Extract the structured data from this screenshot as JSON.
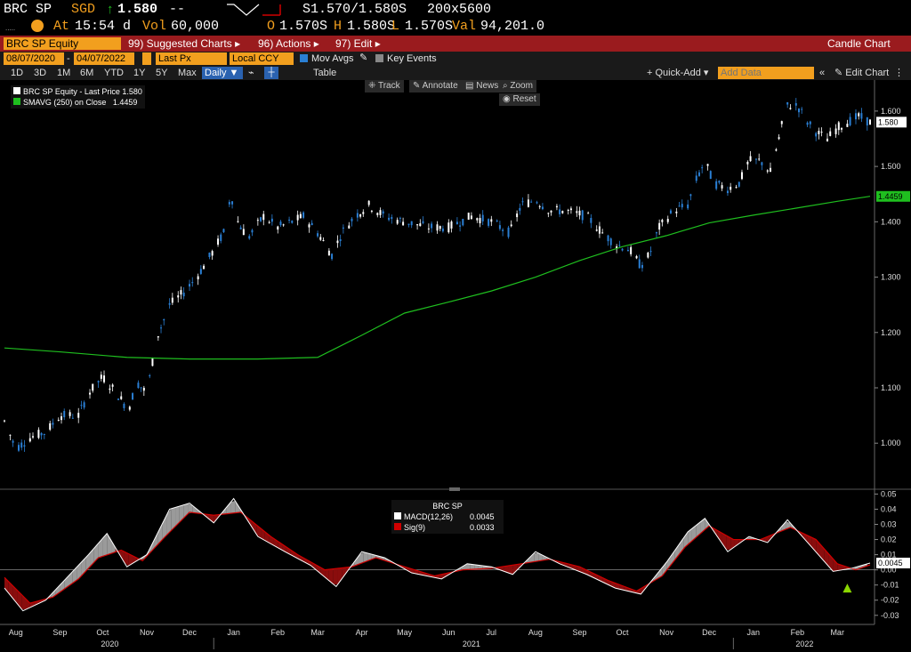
{
  "quote": {
    "ticker": "BRC SP",
    "currency": "SGD",
    "arrow": "↑",
    "last": "1.580",
    "change": "--",
    "bid_ask": "S1.570/1.580S",
    "size": "200x5600",
    "time_label": "At",
    "time": "15:54 d",
    "vol_label": "Vol",
    "vol": "60,000",
    "open_label": "O",
    "open": "1.570S",
    "high_label": "H",
    "high": "1.580S",
    "low_label": "L",
    "low": "1.570S",
    "val_label": "Val",
    "val": "94,201.0"
  },
  "menu": {
    "security": "BRC SP Equity",
    "suggested": "99) Suggested Charts ▸",
    "actions": "96) Actions ▸",
    "edit": "97) Edit ▸",
    "chart_type": "Candle Chart"
  },
  "controls": {
    "start_date": "08/07/2020",
    "end_date": "04/07/2022",
    "price_field": "Last Px",
    "currency": "Local CCY",
    "mov_avgs": "Mov Avgs",
    "key_events": "Key Events",
    "periods": [
      "1D",
      "3D",
      "1M",
      "6M",
      "YTD",
      "1Y",
      "5Y",
      "Max"
    ],
    "frequency": "Daily ▼",
    "table": "Table",
    "quick_add": "+ Quick-Add ▾",
    "add_data_placeholder": "Add Data",
    "edit_chart": "✎ Edit Chart",
    "track": "Track",
    "annotate": "Annotate",
    "news": "News",
    "zoom": "Zoom",
    "reset": "Reset"
  },
  "colors": {
    "up_candle": "#ffffff",
    "down_candle": "#2a7fd4",
    "sma": "#1fbf1f",
    "macd": "#ffffff",
    "signal": "#d00000",
    "menu_bar": "#9a1b1e",
    "orange": "#f29f1e"
  },
  "chart_data": [
    {
      "type": "line",
      "legend": [
        {
          "label": "BRC SP Equity - Last Price 1.580",
          "color": "#ffffff"
        },
        {
          "label": "SMAVG (250) on Close",
          "value": "1.4459",
          "color": "#1fbf1f"
        }
      ],
      "price_type": "candlestick",
      "ylim": [
        0.92,
        1.64
      ],
      "yticks": [
        "1.000",
        "1.100",
        "1.200",
        "1.300",
        "1.400",
        "1.500",
        "1.600"
      ],
      "ytick_values": [
        1.0,
        1.1,
        1.2,
        1.3,
        1.4,
        1.5,
        1.6
      ],
      "last_price_label": "1.580",
      "sma_label": "1.4459",
      "price_series": [
        {
          "x": "2020-08-07",
          "y": 1.04
        },
        {
          "x": "2020-08-15",
          "y": 0.99
        },
        {
          "x": "2020-08-25",
          "y": 1.01
        },
        {
          "x": "2020-09-05",
          "y": 1.02
        },
        {
          "x": "2020-09-15",
          "y": 1.05
        },
        {
          "x": "2020-09-28",
          "y": 1.05
        },
        {
          "x": "2020-10-05",
          "y": 1.09
        },
        {
          "x": "2020-10-15",
          "y": 1.12
        },
        {
          "x": "2020-10-25",
          "y": 1.09
        },
        {
          "x": "2020-11-02",
          "y": 1.06
        },
        {
          "x": "2020-11-08",
          "y": 1.11
        },
        {
          "x": "2020-11-15",
          "y": 1.09
        },
        {
          "x": "2020-11-22",
          "y": 1.19
        },
        {
          "x": "2020-12-01",
          "y": 1.25
        },
        {
          "x": "2020-12-10",
          "y": 1.27
        },
        {
          "x": "2020-12-20",
          "y": 1.3
        },
        {
          "x": "2020-12-30",
          "y": 1.34
        },
        {
          "x": "2021-01-08",
          "y": 1.38
        },
        {
          "x": "2021-01-13",
          "y": 1.45
        },
        {
          "x": "2021-01-18",
          "y": 1.4
        },
        {
          "x": "2021-01-25",
          "y": 1.37
        },
        {
          "x": "2021-02-05",
          "y": 1.41
        },
        {
          "x": "2021-02-15",
          "y": 1.39
        },
        {
          "x": "2021-02-25",
          "y": 1.4
        },
        {
          "x": "2021-03-05",
          "y": 1.41
        },
        {
          "x": "2021-03-15",
          "y": 1.38
        },
        {
          "x": "2021-03-25",
          "y": 1.34
        },
        {
          "x": "2021-04-01",
          "y": 1.38
        },
        {
          "x": "2021-04-10",
          "y": 1.41
        },
        {
          "x": "2021-04-20",
          "y": 1.43
        },
        {
          "x": "2021-05-01",
          "y": 1.41
        },
        {
          "x": "2021-05-15",
          "y": 1.4
        },
        {
          "x": "2021-06-01",
          "y": 1.39
        },
        {
          "x": "2021-06-15",
          "y": 1.39
        },
        {
          "x": "2021-07-01",
          "y": 1.41
        },
        {
          "x": "2021-07-15",
          "y": 1.4
        },
        {
          "x": "2021-07-28",
          "y": 1.38
        },
        {
          "x": "2021-08-05",
          "y": 1.43
        },
        {
          "x": "2021-08-15",
          "y": 1.44
        },
        {
          "x": "2021-08-25",
          "y": 1.42
        },
        {
          "x": "2021-09-05",
          "y": 1.42
        },
        {
          "x": "2021-09-20",
          "y": 1.41
        },
        {
          "x": "2021-10-01",
          "y": 1.38
        },
        {
          "x": "2021-10-10",
          "y": 1.36
        },
        {
          "x": "2021-10-20",
          "y": 1.35
        },
        {
          "x": "2021-10-28",
          "y": 1.32
        },
        {
          "x": "2021-11-03",
          "y": 1.34
        },
        {
          "x": "2021-11-10",
          "y": 1.39
        },
        {
          "x": "2021-11-20",
          "y": 1.42
        },
        {
          "x": "2021-11-30",
          "y": 1.43
        },
        {
          "x": "2021-12-05",
          "y": 1.47
        },
        {
          "x": "2021-12-12",
          "y": 1.51
        },
        {
          "x": "2021-12-18",
          "y": 1.47
        },
        {
          "x": "2021-12-28",
          "y": 1.46
        },
        {
          "x": "2022-01-05",
          "y": 1.47
        },
        {
          "x": "2022-01-12",
          "y": 1.51
        },
        {
          "x": "2022-01-20",
          "y": 1.51
        },
        {
          "x": "2022-01-27",
          "y": 1.49
        },
        {
          "x": "2022-02-02",
          "y": 1.55
        },
        {
          "x": "2022-02-07",
          "y": 1.61
        },
        {
          "x": "2022-02-15",
          "y": 1.61
        },
        {
          "x": "2022-02-22",
          "y": 1.58
        },
        {
          "x": "2022-03-01",
          "y": 1.56
        },
        {
          "x": "2022-03-08",
          "y": 1.55
        },
        {
          "x": "2022-03-15",
          "y": 1.57
        },
        {
          "x": "2022-03-22",
          "y": 1.58
        },
        {
          "x": "2022-03-30",
          "y": 1.59
        },
        {
          "x": "2022-04-07",
          "y": 1.58
        }
      ],
      "sma_series": [
        {
          "x": "2020-08-07",
          "y": 1.172
        },
        {
          "x": "2020-09-15",
          "y": 1.165
        },
        {
          "x": "2020-11-01",
          "y": 1.155
        },
        {
          "x": "2020-12-15",
          "y": 1.152
        },
        {
          "x": "2021-02-01",
          "y": 1.152
        },
        {
          "x": "2021-03-15",
          "y": 1.155
        },
        {
          "x": "2021-04-15",
          "y": 1.195
        },
        {
          "x": "2021-05-15",
          "y": 1.235
        },
        {
          "x": "2021-06-15",
          "y": 1.255
        },
        {
          "x": "2021-07-15",
          "y": 1.275
        },
        {
          "x": "2021-08-15",
          "y": 1.3
        },
        {
          "x": "2021-09-15",
          "y": 1.33
        },
        {
          "x": "2021-10-15",
          "y": 1.355
        },
        {
          "x": "2021-11-15",
          "y": 1.375
        },
        {
          "x": "2021-12-15",
          "y": 1.398
        },
        {
          "x": "2022-01-15",
          "y": 1.412
        },
        {
          "x": "2022-02-15",
          "y": 1.425
        },
        {
          "x": "2022-03-15",
          "y": 1.437
        },
        {
          "x": "2022-04-07",
          "y": 1.446
        }
      ]
    },
    {
      "type": "line",
      "title": "BRC SP",
      "series": [
        {
          "name": "MACD(12,26)",
          "value": "0.0045"
        },
        {
          "name": "Sig(9)",
          "value": "0.0033"
        }
      ],
      "ylim": [
        -0.036,
        0.052
      ],
      "yticks": [
        "0.05",
        "0.04",
        "0.03",
        "0.02",
        "0.01",
        "0.00",
        "-0.01",
        "-0.02",
        "-0.03"
      ],
      "ytick_values": [
        0.05,
        0.04,
        0.03,
        0.02,
        0.01,
        0.0,
        -0.01,
        -0.02,
        -0.03
      ],
      "last_label": "0.0045",
      "macd_series": [
        {
          "x": "2020-08-07",
          "y": -0.012
        },
        {
          "x": "2020-08-20",
          "y": -0.027
        },
        {
          "x": "2020-09-05",
          "y": -0.02
        },
        {
          "x": "2020-09-20",
          "y": -0.005
        },
        {
          "x": "2020-10-05",
          "y": 0.01
        },
        {
          "x": "2020-10-18",
          "y": 0.024
        },
        {
          "x": "2020-11-01",
          "y": 0.002
        },
        {
          "x": "2020-11-15",
          "y": 0.01
        },
        {
          "x": "2020-12-01",
          "y": 0.04
        },
        {
          "x": "2020-12-15",
          "y": 0.044
        },
        {
          "x": "2021-01-01",
          "y": 0.031
        },
        {
          "x": "2021-01-15",
          "y": 0.047
        },
        {
          "x": "2021-02-01",
          "y": 0.022
        },
        {
          "x": "2021-02-20",
          "y": 0.012
        },
        {
          "x": "2021-03-10",
          "y": 0.003
        },
        {
          "x": "2021-03-28",
          "y": -0.011
        },
        {
          "x": "2021-04-15",
          "y": 0.012
        },
        {
          "x": "2021-05-01",
          "y": 0.008
        },
        {
          "x": "2021-05-20",
          "y": -0.002
        },
        {
          "x": "2021-06-10",
          "y": -0.006
        },
        {
          "x": "2021-06-28",
          "y": 0.004
        },
        {
          "x": "2021-07-15",
          "y": 0.002
        },
        {
          "x": "2021-07-30",
          "y": -0.003
        },
        {
          "x": "2021-08-15",
          "y": 0.012
        },
        {
          "x": "2021-09-01",
          "y": 0.004
        },
        {
          "x": "2021-09-20",
          "y": -0.003
        },
        {
          "x": "2021-10-10",
          "y": -0.012
        },
        {
          "x": "2021-10-28",
          "y": -0.016
        },
        {
          "x": "2021-11-15",
          "y": 0.005
        },
        {
          "x": "2021-11-30",
          "y": 0.025
        },
        {
          "x": "2021-12-12",
          "y": 0.034
        },
        {
          "x": "2021-12-28",
          "y": 0.012
        },
        {
          "x": "2022-01-12",
          "y": 0.022
        },
        {
          "x": "2022-01-25",
          "y": 0.018
        },
        {
          "x": "2022-02-08",
          "y": 0.033
        },
        {
          "x": "2022-02-25",
          "y": 0.015
        },
        {
          "x": "2022-03-12",
          "y": -0.001
        },
        {
          "x": "2022-03-25",
          "y": 0.001
        },
        {
          "x": "2022-04-07",
          "y": 0.0045
        }
      ],
      "signal_series": [
        {
          "x": "2020-08-07",
          "y": -0.005
        },
        {
          "x": "2020-08-25",
          "y": -0.022
        },
        {
          "x": "2020-09-10",
          "y": -0.018
        },
        {
          "x": "2020-09-28",
          "y": -0.006
        },
        {
          "x": "2020-10-12",
          "y": 0.008
        },
        {
          "x": "2020-10-28",
          "y": 0.013
        },
        {
          "x": "2020-11-12",
          "y": 0.006
        },
        {
          "x": "2020-11-28",
          "y": 0.022
        },
        {
          "x": "2020-12-15",
          "y": 0.038
        },
        {
          "x": "2021-01-01",
          "y": 0.036
        },
        {
          "x": "2021-01-20",
          "y": 0.038
        },
        {
          "x": "2021-02-10",
          "y": 0.022
        },
        {
          "x": "2021-03-01",
          "y": 0.01
        },
        {
          "x": "2021-03-20",
          "y": 0.0
        },
        {
          "x": "2021-04-08",
          "y": 0.002
        },
        {
          "x": "2021-04-25",
          "y": 0.008
        },
        {
          "x": "2021-05-15",
          "y": 0.002
        },
        {
          "x": "2021-06-05",
          "y": -0.004
        },
        {
          "x": "2021-06-25",
          "y": 0.0
        },
        {
          "x": "2021-07-15",
          "y": 0.001
        },
        {
          "x": "2021-08-05",
          "y": 0.004
        },
        {
          "x": "2021-08-25",
          "y": 0.007
        },
        {
          "x": "2021-09-15",
          "y": 0.002
        },
        {
          "x": "2021-10-05",
          "y": -0.007
        },
        {
          "x": "2021-10-25",
          "y": -0.014
        },
        {
          "x": "2021-11-12",
          "y": -0.004
        },
        {
          "x": "2021-11-28",
          "y": 0.015
        },
        {
          "x": "2021-12-15",
          "y": 0.029
        },
        {
          "x": "2022-01-01",
          "y": 0.02
        },
        {
          "x": "2022-01-20",
          "y": 0.02
        },
        {
          "x": "2022-02-10",
          "y": 0.028
        },
        {
          "x": "2022-02-28",
          "y": 0.02
        },
        {
          "x": "2022-03-15",
          "y": 0.004
        },
        {
          "x": "2022-03-28",
          "y": 0.0
        },
        {
          "x": "2022-04-07",
          "y": 0.0033
        }
      ]
    }
  ],
  "xaxis": {
    "months": [
      {
        "label": "Aug",
        "date": "2020-08-15"
      },
      {
        "label": "Sep",
        "date": "2020-09-15"
      },
      {
        "label": "Oct",
        "date": "2020-10-15"
      },
      {
        "label": "Nov",
        "date": "2020-11-15"
      },
      {
        "label": "Dec",
        "date": "2020-12-15"
      },
      {
        "label": "Jan",
        "date": "2021-01-15"
      },
      {
        "label": "Feb",
        "date": "2021-02-15"
      },
      {
        "label": "Mar",
        "date": "2021-03-15"
      },
      {
        "label": "Apr",
        "date": "2021-04-15"
      },
      {
        "label": "May",
        "date": "2021-05-15"
      },
      {
        "label": "Jun",
        "date": "2021-06-15"
      },
      {
        "label": "Jul",
        "date": "2021-07-15"
      },
      {
        "label": "Aug",
        "date": "2021-08-15"
      },
      {
        "label": "Sep",
        "date": "2021-09-15"
      },
      {
        "label": "Oct",
        "date": "2021-10-15"
      },
      {
        "label": "Nov",
        "date": "2021-11-15"
      },
      {
        "label": "Dec",
        "date": "2021-12-15"
      },
      {
        "label": "Jan",
        "date": "2022-01-15"
      },
      {
        "label": "Feb",
        "date": "2022-02-15"
      },
      {
        "label": "Mar",
        "date": "2022-03-15"
      }
    ],
    "years": [
      {
        "label": "2020",
        "date": "2020-10-20"
      },
      {
        "label": "2021",
        "date": "2021-07-01"
      },
      {
        "label": "2022",
        "date": "2022-02-20"
      }
    ]
  }
}
